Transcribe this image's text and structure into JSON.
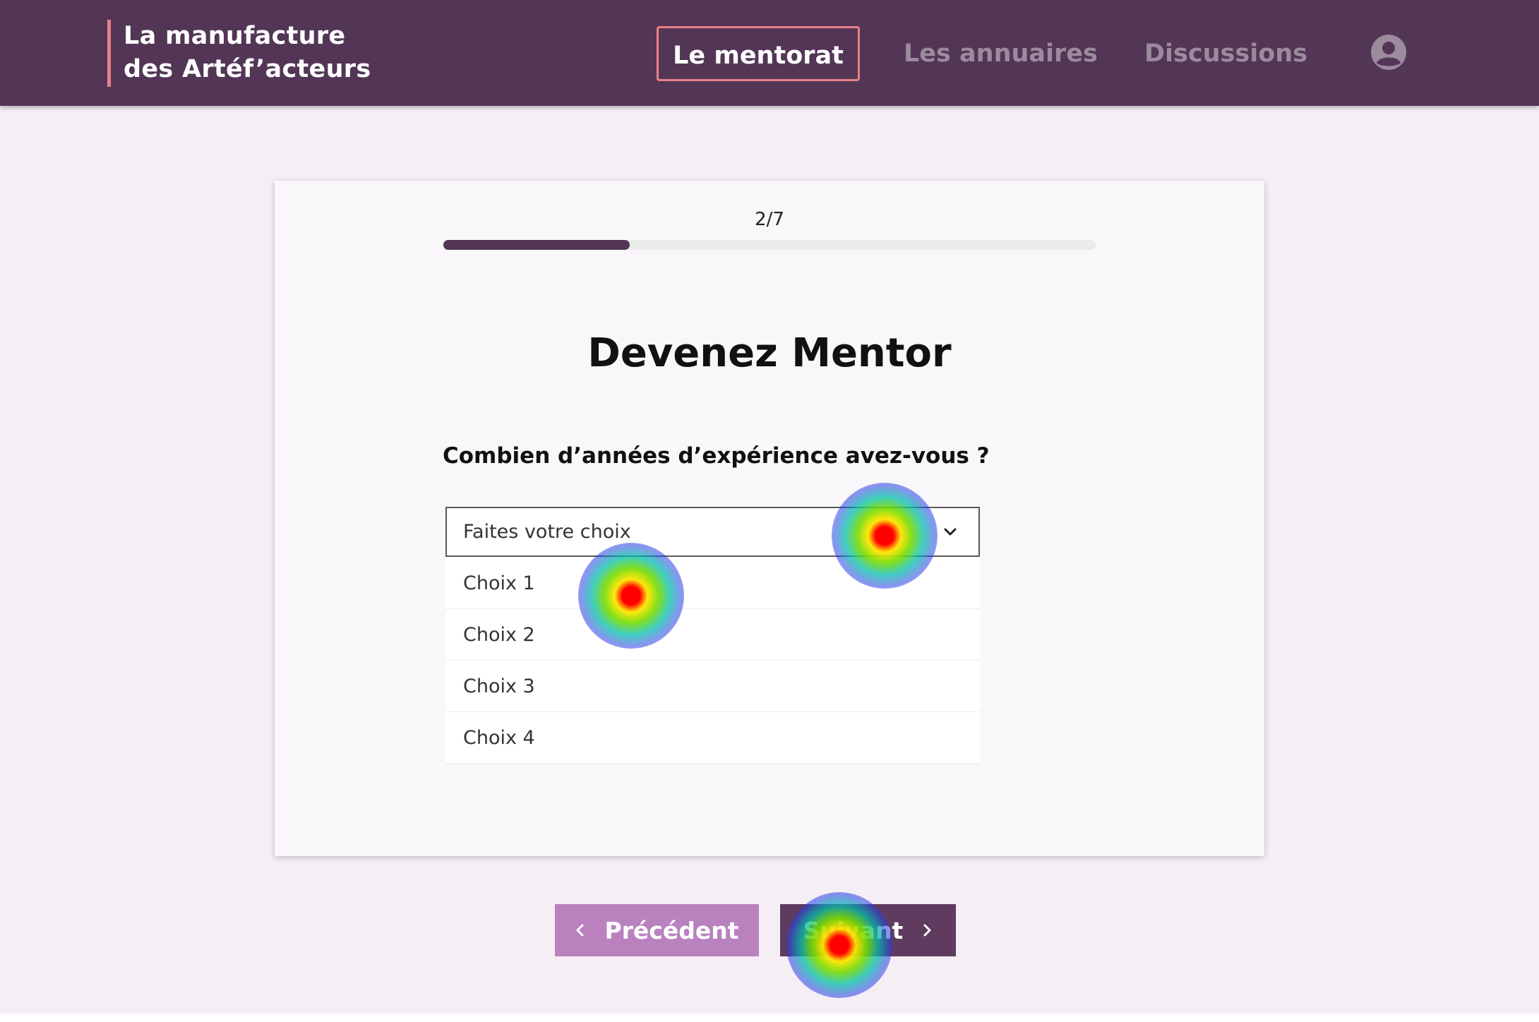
{
  "header": {
    "brand_line1": "La manufacture",
    "brand_line2": "des Artéf’acteurs",
    "nav": {
      "mentorat": "Le mentorat",
      "annuaires": "Les annuaires",
      "discussions": "Discussions"
    },
    "profile_icon": "user-circle-icon"
  },
  "colors": {
    "header_bg": "#533656",
    "accent": "#e8808a",
    "progress": "#533656",
    "prev_button": "#b982bf",
    "next_button": "#5f3c5f"
  },
  "form": {
    "step": "2/7",
    "progress_fraction": 0.286,
    "title": "Devenez Mentor",
    "question": "Combien d’années d’expérience avez-vous ?",
    "select_placeholder": "Faites votre choix",
    "options": [
      "Choix 1",
      "Choix 2",
      "Choix 3",
      "Choix 4"
    ]
  },
  "buttons": {
    "prev": "Précédent",
    "next": "Suivant"
  }
}
